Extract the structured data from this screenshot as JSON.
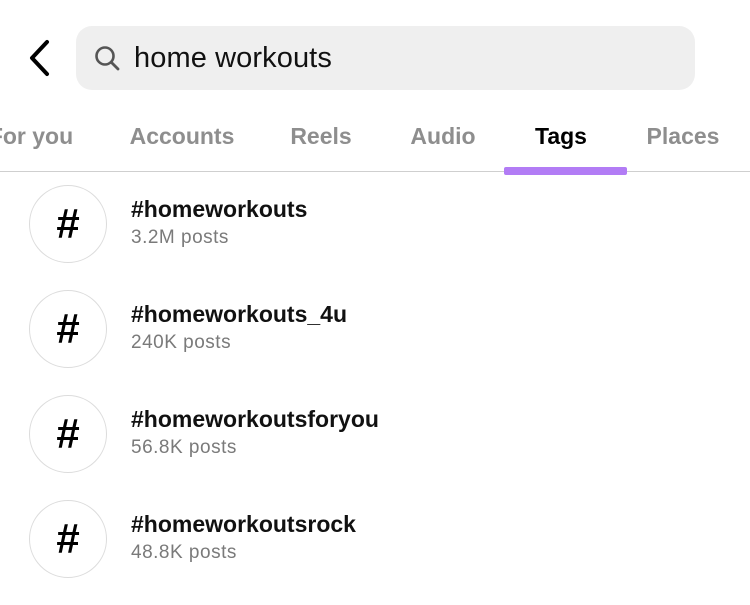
{
  "header": {
    "back_icon": "chevron-left-icon",
    "search": {
      "icon": "search-icon",
      "value": "home workouts"
    }
  },
  "tabs": [
    {
      "label": "For you",
      "active": false
    },
    {
      "label": "Accounts",
      "active": false
    },
    {
      "label": "Reels",
      "active": false
    },
    {
      "label": "Audio",
      "active": false
    },
    {
      "label": "Tags",
      "active": true
    },
    {
      "label": "Places",
      "active": false
    }
  ],
  "colors": {
    "active_tab_underline": "#b27cf5",
    "search_background": "#efefef",
    "secondary_text": "#7a7a7a"
  },
  "results": [
    {
      "icon_glyph": "#",
      "name": "#homeworkouts",
      "count": "3.2M posts"
    },
    {
      "icon_glyph": "#",
      "name": "#homeworkouts_4u",
      "count": "240K posts"
    },
    {
      "icon_glyph": "#",
      "name": "#homeworkoutsforyou",
      "count": "56.8K posts"
    },
    {
      "icon_glyph": "#",
      "name": "#homeworkoutsrock",
      "count": "48.8K posts"
    }
  ]
}
